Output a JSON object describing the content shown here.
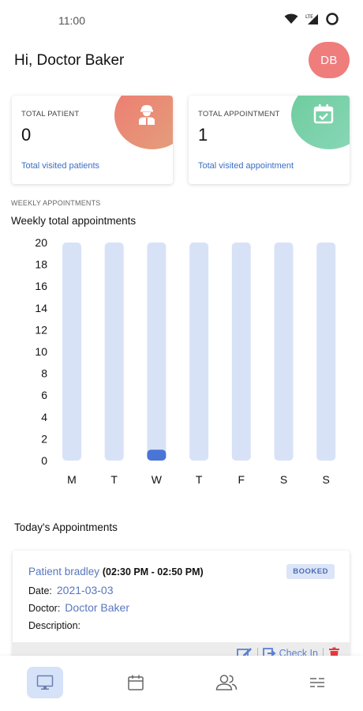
{
  "status_bar": {
    "time": "11:00",
    "network": "LTE"
  },
  "header": {
    "greeting": "Hi, Doctor Baker",
    "avatar_initials": "DB"
  },
  "stats": [
    {
      "label": "TOTAL PATIENT",
      "value": "0",
      "link": "Total visited patients",
      "icon": "doctor-icon",
      "color": "#ee7b72"
    },
    {
      "label": "TOTAL APPOINTMENT",
      "value": "1",
      "link": "Total visited appointment",
      "icon": "calendar-check-icon",
      "color": "#6ccb9b"
    }
  ],
  "weekly": {
    "section_label": "WEEKLY APPOINTMENTS",
    "title": "Weekly total appointments"
  },
  "chart_data": {
    "type": "bar",
    "categories": [
      "M",
      "T",
      "W",
      "T",
      "F",
      "S",
      "S"
    ],
    "values": [
      0,
      0,
      1,
      0,
      0,
      0,
      0
    ],
    "ylim": [
      0,
      20
    ],
    "yticks": [
      0,
      2,
      4,
      6,
      8,
      10,
      12,
      14,
      16,
      18,
      20
    ],
    "title": "",
    "xlabel": "",
    "ylabel": "",
    "grid": false,
    "bar_color": "#4a74d6",
    "track_color": "#d8e2f7"
  },
  "today": {
    "title": "Today's Appointments",
    "appointment": {
      "patient": "Patient bradley",
      "time": "(02:30 PM - 02:50 PM)",
      "status": "BOOKED",
      "date_label": "Date:",
      "date": "2021-03-03",
      "doctor_label": "Doctor:",
      "doctor": "Doctor Baker",
      "description_label": "Description:",
      "description": "",
      "checkin_label": "Check In"
    }
  },
  "nav": [
    {
      "icon": "monitor-icon",
      "active": true
    },
    {
      "icon": "calendar-icon",
      "active": false
    },
    {
      "icon": "users-icon",
      "active": false
    },
    {
      "icon": "menu-icon",
      "active": false
    }
  ]
}
